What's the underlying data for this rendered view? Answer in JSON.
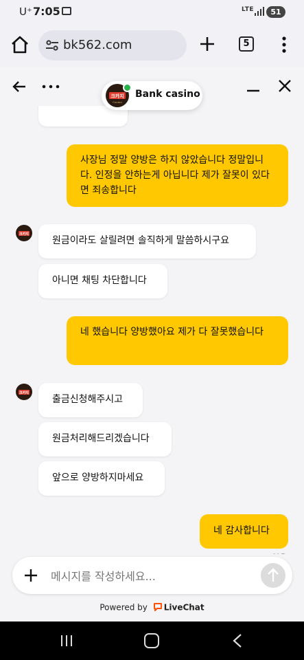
{
  "status_bar": {
    "carrier": "U⁺",
    "time": "7:05",
    "network": "LTE",
    "battery": "51"
  },
  "browser": {
    "url": "bk562.com",
    "tab_count": "5"
  },
  "chat_header": {
    "agent_name": "Bank casino"
  },
  "avatar": {
    "text_main": "크카지",
    "text_sub": "Casino"
  },
  "messages": [
    {
      "from": "visitor",
      "text": "사장님 정말 양방은 하지 않았습니다 정말입니다. 인정을 안하는게 아닙니다 제가 잘못이 있다면 죄송합니다"
    },
    {
      "from": "agent",
      "text": "원금이라도 살릴려면 솔직하게 말씀하시구요"
    },
    {
      "from": "agent",
      "text": "아니면 채팅 차단합니다"
    },
    {
      "from": "visitor",
      "text": "네 했습니다 양방했아요 제가 다 잘못했습니다"
    },
    {
      "from": "agent",
      "text": "출금신청해주시고"
    },
    {
      "from": "agent",
      "text": "원금처리해드리겠습니다"
    },
    {
      "from": "agent",
      "text": "앞으로 양방하지마세요"
    },
    {
      "from": "visitor",
      "text": "네 감사합니다"
    }
  ],
  "read_status": "읽음",
  "composer": {
    "placeholder": "메시지를 작성하세요..."
  },
  "footer": {
    "powered_by": "Powered by",
    "brand": "LiveChat"
  },
  "colors": {
    "visitor_bubble": "#ffc800",
    "agent_bubble": "#ffffff",
    "online": "#2bb24c",
    "livechat": "#ff5100"
  }
}
